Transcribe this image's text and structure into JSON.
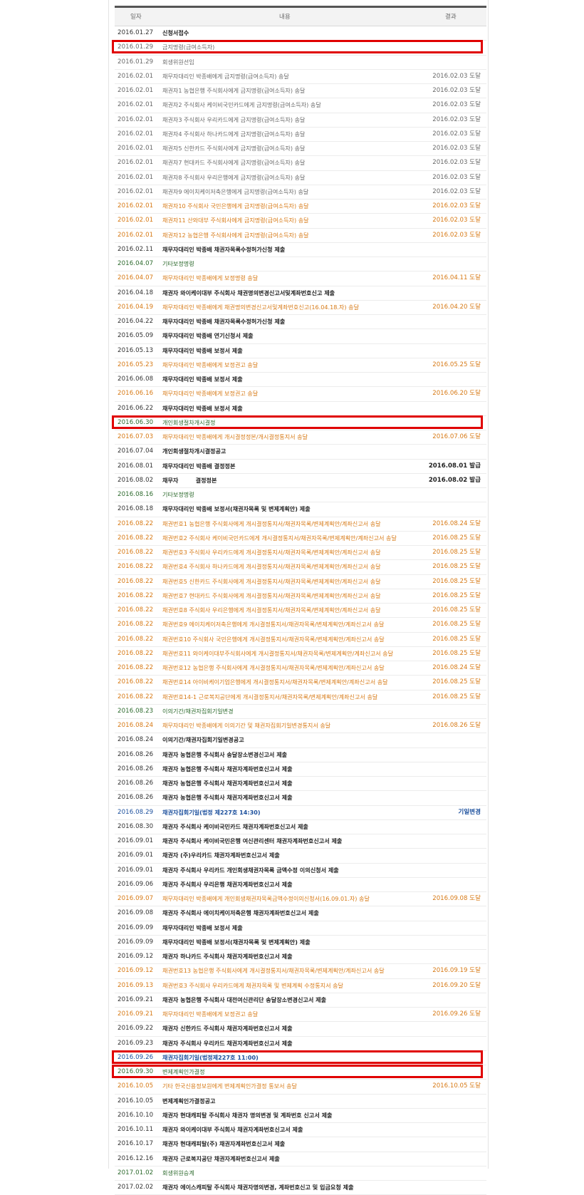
{
  "header": {
    "date": "일자",
    "content": "내용",
    "result": "결과"
  },
  "rows": [
    {
      "date": "2016.01.27",
      "content": "신청서접수",
      "result": "",
      "type": "black",
      "hl": false
    },
    {
      "date": "2016.01.29",
      "content": "금지명령(급여소득자)",
      "result": "",
      "type": "gray",
      "hl": true
    },
    {
      "date": "2016.01.29",
      "content": "회생위원선임",
      "result": "",
      "type": "gray",
      "hl": false
    },
    {
      "date": "2016.02.01",
      "content": "채무자대리인 박종배에게 금지명령(급여소득자) 송달",
      "result": "2016.02.03 도달",
      "type": "gray",
      "hl": false
    },
    {
      "date": "2016.02.01",
      "content": "채권자1 농협은행 주식회사에게 금지명령(급여소득자) 송달",
      "result": "2016.02.03 도달",
      "type": "gray",
      "hl": false
    },
    {
      "date": "2016.02.01",
      "content": "채권자2 주식회사 케이비국민카드에게 금지명령(급여소득자) 송달",
      "result": "2016.02.03 도달",
      "type": "gray",
      "hl": false
    },
    {
      "date": "2016.02.01",
      "content": "채권자3 주식회사 우리카드에게 금지명령(급여소득자) 송달",
      "result": "2016.02.03 도달",
      "type": "gray",
      "hl": false
    },
    {
      "date": "2016.02.01",
      "content": "채권자4 주식회사 하나카드에게 금지명령(급여소득자) 송달",
      "result": "2016.02.03 도달",
      "type": "gray",
      "hl": false
    },
    {
      "date": "2016.02.01",
      "content": "채권자5 신한카드 주식회사에게 금지명령(급여소득자) 송달",
      "result": "2016.02.03 도달",
      "type": "gray",
      "hl": false
    },
    {
      "date": "2016.02.01",
      "content": "채권자7 현대카드 주식회사에게 금지명령(급여소득자) 송달",
      "result": "2016.02.03 도달",
      "type": "gray",
      "hl": false
    },
    {
      "date": "2016.02.01",
      "content": "채권자8 주식회사 우리은행에게 금지명령(급여소득자) 송달",
      "result": "2016.02.03 도달",
      "type": "gray",
      "hl": false
    },
    {
      "date": "2016.02.01",
      "content": "채권자9 에이치케이저축은행에게 금지명령(급여소득자) 송달",
      "result": "2016.02.03 도달",
      "type": "gray",
      "hl": false
    },
    {
      "date": "2016.02.01",
      "content": "채권자10 주식회사 국민은행에게 금지명령(급여소득자) 송달",
      "result": "2016.02.03 도달",
      "type": "orange",
      "hl": false
    },
    {
      "date": "2016.02.01",
      "content": "채권자11 산와대부 주식회사에게 금지명령(급여소득자) 송달",
      "result": "2016.02.03 도달",
      "type": "orange",
      "hl": false
    },
    {
      "date": "2016.02.01",
      "content": "채권자12 농협은행 주식회사에게 금지명령(급여소득자) 송달",
      "result": "2016.02.03 도달",
      "type": "orange",
      "hl": false
    },
    {
      "date": "2016.02.11",
      "content": "채무자대리인 박종배 채권자목록수정허가신청 제출",
      "result": "",
      "type": "black",
      "hl": false
    },
    {
      "date": "2016.04.07",
      "content": "기타보정명령",
      "result": "",
      "type": "green",
      "hl": false
    },
    {
      "date": "2016.04.07",
      "content": "채무자대리인 박종배에게 보정명령 송달",
      "result": "2016.04.11 도달",
      "type": "orange",
      "hl": false
    },
    {
      "date": "2016.04.18",
      "content": "채권자 와이케이대부 주식회사 채권명의변경신고서및계좌번호신고 제출",
      "result": "",
      "type": "black",
      "hl": false
    },
    {
      "date": "2016.04.19",
      "content": "채무자대리인 박종배에게 채권명의변경신고서및계좌번호신고(16.04.18.자) 송달",
      "result": "2016.04.20 도달",
      "type": "orange",
      "hl": false
    },
    {
      "date": "2016.04.22",
      "content": "채무자대리인 박종배 채권자목록수정허가신청 제출",
      "result": "",
      "type": "black",
      "hl": false
    },
    {
      "date": "2016.05.09",
      "content": "채무자대리인 박종배 연기신청서 제출",
      "result": "",
      "type": "black",
      "hl": false
    },
    {
      "date": "2016.05.13",
      "content": "채무자대리인 박종배 보정서 제출",
      "result": "",
      "type": "black",
      "hl": false
    },
    {
      "date": "2016.05.23",
      "content": "채무자대리인 박종배에게 보정권고 송달",
      "result": "2016.05.25 도달",
      "type": "orange",
      "hl": false
    },
    {
      "date": "2016.06.08",
      "content": "채무자대리인 박종배 보정서 제출",
      "result": "",
      "type": "black",
      "hl": false
    },
    {
      "date": "2016.06.16",
      "content": "채무자대리인 박종배에게 보정권고 송달",
      "result": "2016.06.20 도달",
      "type": "orange",
      "hl": false
    },
    {
      "date": "2016.06.22",
      "content": "채무자대리인 박종배 보정서 제출",
      "result": "",
      "type": "black",
      "hl": false
    },
    {
      "date": "2016.06.30",
      "content": "개인회생절차개시결정",
      "result": "",
      "type": "green",
      "hl": true
    },
    {
      "date": "2016.07.03",
      "content": "채무자대리인 박종배에게 개시결정정본/개시결정통지서 송달",
      "result": "2016.07.06 도달",
      "type": "orange",
      "hl": false
    },
    {
      "date": "2016.07.04",
      "content": "개인회생절차개시결정공고",
      "result": "",
      "type": "black",
      "hl": false
    },
    {
      "date": "2016.08.01",
      "content": "채무자대리인 박종배 결정정본",
      "result": "2016.08.01 발급",
      "type": "black",
      "hl": false
    },
    {
      "date": "2016.08.02",
      "content": "채무자　　　결정정본",
      "result": "2016.08.02 발급",
      "type": "black",
      "hl": false
    },
    {
      "date": "2016.08.16",
      "content": "기타보정명령",
      "result": "",
      "type": "green",
      "hl": false
    },
    {
      "date": "2016.08.18",
      "content": "채무자대리인 박종배 보정서(채권자목록 및 변제계획안) 제출",
      "result": "",
      "type": "black",
      "hl": false
    },
    {
      "date": "2016.08.22",
      "content": "채권번호1 농협은행 주식회사에게 개시결정통지서/채권자목록/변제계획안/계좌신고서 송달",
      "result": "2016.08.24 도달",
      "type": "orange",
      "hl": false
    },
    {
      "date": "2016.08.22",
      "content": "채권번호2 주식회사 케이비국민카드에게 개시결정통지서/채권자목록/변제계획안/계좌신고서 송달",
      "result": "2016.08.25 도달",
      "type": "orange",
      "hl": false
    },
    {
      "date": "2016.08.22",
      "content": "채권번호3 주식회사 우리카드에게 개시결정통지서/채권자목록/변제계획안/계좌신고서 송달",
      "result": "2016.08.25 도달",
      "type": "orange",
      "hl": false
    },
    {
      "date": "2016.08.22",
      "content": "채권번호4 주식회사 하나카드에게 개시결정통지서/채권자목록/변제계획안/계좌신고서 송달",
      "result": "2016.08.25 도달",
      "type": "orange",
      "hl": false
    },
    {
      "date": "2016.08.22",
      "content": "채권번호5 신한카드 주식회사에게 개시결정통지서/채권자목록/변제계획안/계좌신고서 송달",
      "result": "2016.08.25 도달",
      "type": "orange",
      "hl": false
    },
    {
      "date": "2016.08.22",
      "content": "채권번호7 현대카드 주식회사에게 개시결정통지서/채권자목록/변제계획안/계좌신고서 송달",
      "result": "2016.08.25 도달",
      "type": "orange",
      "hl": false
    },
    {
      "date": "2016.08.22",
      "content": "채권번호8 주식회사 우리은행에게 개시결정통지서/채권자목록/변제계획안/계좌신고서 송달",
      "result": "2016.08.25 도달",
      "type": "orange",
      "hl": false
    },
    {
      "date": "2016.08.22",
      "content": "채권번호9 에이치케이저축은행에게 개시결정통지서/채권자목록/변제계획안/계좌신고서 송달",
      "result": "2016.08.25 도달",
      "type": "orange",
      "hl": false
    },
    {
      "date": "2016.08.22",
      "content": "채권번호10 주식회사 국민은행에게 개시결정통지서/채권자목록/변제계획안/계좌신고서 송달",
      "result": "2016.08.25 도달",
      "type": "orange",
      "hl": false
    },
    {
      "date": "2016.08.22",
      "content": "채권번호11 와이케이대부주식회사에게 개시결정통지서/채권자목록/변제계획안/계좌신고서 송달",
      "result": "2016.08.25 도달",
      "type": "orange",
      "hl": false
    },
    {
      "date": "2016.08.22",
      "content": "채권번호12 농협은행 주식회사에게 개시결정통지서/채권자목록/변제계획안/계좌신고서 송달",
      "result": "2016.08.24 도달",
      "type": "orange",
      "hl": false
    },
    {
      "date": "2016.08.22",
      "content": "채권번호14 아이비케이기업은행에게 개시결정통지서/채권자목록/변제계획안/계좌신고서 송달",
      "result": "2016.08.25 도달",
      "type": "orange",
      "hl": false
    },
    {
      "date": "2016.08.22",
      "content": "채권번호14-1 근로복지공단에게 개시결정통지서/채권자목록/변제계획안/계좌신고서 송달",
      "result": "2016.08.25 도달",
      "type": "orange",
      "hl": false
    },
    {
      "date": "2016.08.23",
      "content": "이의기간/채권자집회기일변경",
      "result": "",
      "type": "green",
      "hl": false
    },
    {
      "date": "2016.08.24",
      "content": "채무자대리인 박종배에게 이의기간 및 채권자집회기일변경통지서 송달",
      "result": "2016.08.26 도달",
      "type": "orange",
      "hl": false
    },
    {
      "date": "2016.08.24",
      "content": "이의기간/채권자집회기일변경공고",
      "result": "",
      "type": "black",
      "hl": false
    },
    {
      "date": "2016.08.26",
      "content": "채권자 농협은행 주식회사 송달장소변경신고서 제출",
      "result": "",
      "type": "black",
      "hl": false
    },
    {
      "date": "2016.08.26",
      "content": "채권자 농협은행 주식회사 채권자계좌번호신고서 제출",
      "result": "",
      "type": "black",
      "hl": false
    },
    {
      "date": "2016.08.26",
      "content": "채권자 농협은행 주식회사 채권자계좌번호신고서 제출",
      "result": "",
      "type": "black",
      "hl": false
    },
    {
      "date": "2016.08.26",
      "content": "채권자 농협은행 주식회사 채권자계좌번호신고서 제출",
      "result": "",
      "type": "black",
      "hl": false
    },
    {
      "date": "2016.08.29",
      "content": "채권자집회기일(법정 제227호 14:30)",
      "result": "기일변경",
      "type": "blue",
      "hl": false
    },
    {
      "date": "2016.08.30",
      "content": "채권자 주식회사 케이비국민카드 채권자계좌번호신고서 제출",
      "result": "",
      "type": "black",
      "hl": false
    },
    {
      "date": "2016.09.01",
      "content": "채권자 주식회사 케이비국민은행 여신관리센터 채권자계좌번호신고서 제출",
      "result": "",
      "type": "black",
      "hl": false
    },
    {
      "date": "2016.09.01",
      "content": "채권자 (주)우리카드 채권자계좌번호신고서 제출",
      "result": "",
      "type": "black",
      "hl": false
    },
    {
      "date": "2016.09.01",
      "content": "채권자 주식회사 우리카드 개인회생채권자목록 금액수정 이의신청서 제출",
      "result": "",
      "type": "black",
      "hl": false
    },
    {
      "date": "2016.09.06",
      "content": "채권자 주식회사 우리은행 채권자계좌번호신고서 제출",
      "result": "",
      "type": "black",
      "hl": false
    },
    {
      "date": "2016.09.07",
      "content": "채무자대리인 박종배에게 개인회생채권자목록금액수정이의신청서(16.09.01.자) 송달",
      "result": "2016.09.08 도달",
      "type": "orange",
      "hl": false
    },
    {
      "date": "2016.09.08",
      "content": "채권자 주식회사 에이치케이저축은행 채권자계좌번호신고서 제출",
      "result": "",
      "type": "black",
      "hl": false
    },
    {
      "date": "2016.09.09",
      "content": "채무자대리인 박종배 보정서 제출",
      "result": "",
      "type": "black",
      "hl": false
    },
    {
      "date": "2016.09.09",
      "content": "채무자대리인 박종배 보정서(채권자목록 및 변제계획안) 제출",
      "result": "",
      "type": "black",
      "hl": false
    },
    {
      "date": "2016.09.12",
      "content": "채권자 하나카드 주식회사 채권자계좌번호신고서 제출",
      "result": "",
      "type": "black",
      "hl": false
    },
    {
      "date": "2016.09.12",
      "content": "채권번호13 농협은행 주식회사에게 개시결정통지서/채권자목록/변제계획안/계좌신고서 송달",
      "result": "2016.09.19 도달",
      "type": "orange",
      "hl": false
    },
    {
      "date": "2016.09.13",
      "content": "채권번호3 주식회사 우리카드에게 채권자목록 및 변제계획 수정통지서 송달",
      "result": "2016.09.20 도달",
      "type": "orange",
      "hl": false
    },
    {
      "date": "2016.09.21",
      "content": "채권자 농협은행 주식회사 대전여신관리단 송달장소변경신고서 제출",
      "result": "",
      "type": "black",
      "hl": false
    },
    {
      "date": "2016.09.21",
      "content": "채무자대리인 박종배에게 보정권고 송달",
      "result": "2016.09.26 도달",
      "type": "orange",
      "hl": false
    },
    {
      "date": "2016.09.22",
      "content": "채권자 신한카드 주식회사 채권자계좌번호신고서 제출",
      "result": "",
      "type": "black",
      "hl": false
    },
    {
      "date": "2016.09.23",
      "content": "채권자 주식회사 우리카드 채권자계좌번호신고서 제출",
      "result": "",
      "type": "black",
      "hl": false
    },
    {
      "date": "2016.09.26",
      "content": "채권자집회기일(법정제227호 11:00)",
      "result": "",
      "type": "blue",
      "hl": true
    },
    {
      "date": "2016.09.30",
      "content": "변제계획인가결정",
      "result": "",
      "type": "green",
      "hl": true
    },
    {
      "date": "2016.10.05",
      "content": "기타 한국신용정보원에게 변제계획인가결정 통보서 송달",
      "result": "2016.10.05 도달",
      "type": "orange",
      "hl": false
    },
    {
      "date": "2016.10.05",
      "content": "변제계획인가결정공고",
      "result": "",
      "type": "black",
      "hl": false
    },
    {
      "date": "2016.10.10",
      "content": "채권자 현대캐피탈 주식회사 채권자 명의변경 및 계좌번호 신고서 제출",
      "result": "",
      "type": "black",
      "hl": false
    },
    {
      "date": "2016.10.11",
      "content": "채권자 와이케이대부 주식회사 채권자계좌번호신고서 제출",
      "result": "",
      "type": "black",
      "hl": false
    },
    {
      "date": "2016.10.17",
      "content": "채권자 현대캐피탈(주) 채권자계좌번호신고서 제출",
      "result": "",
      "type": "black",
      "hl": false
    },
    {
      "date": "2016.12.16",
      "content": "채권자 근로복지공단 채권자계좌번호신고서 제출",
      "result": "",
      "type": "black",
      "hl": false
    },
    {
      "date": "2017.01.02",
      "content": "회생위원승계",
      "result": "",
      "type": "green",
      "hl": false
    },
    {
      "date": "2017.02.02",
      "content": "채권자 에이스캐피탈 주식회사 채권자명의변경, 계좌번호신고 및 입금요청 제출",
      "result": "",
      "type": "black",
      "hl": false
    }
  ]
}
